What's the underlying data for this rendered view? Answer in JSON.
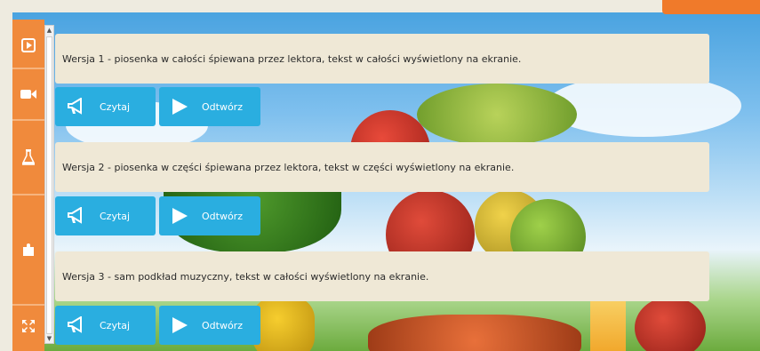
{
  "versions": [
    {
      "text": "Wersja 1 - piosenka w całości śpiewana przez lektora, tekst w całości wyświetlony na ekranie.",
      "read_label": "Czytaj",
      "play_label": "Odtwórz"
    },
    {
      "text": "Wersja 2 - piosenka w części śpiewana przez lektora, tekst w części wyświetlony na ekranie.",
      "read_label": "Czytaj",
      "play_label": "Odtwórz"
    },
    {
      "text": "Wersja 3 - sam podkład muzyczny, tekst w całości wyświetlony na ekranie.",
      "read_label": "Czytaj",
      "play_label": "Odtwórz"
    }
  ],
  "sidebar": {
    "items": [
      {
        "icon": "play-square-icon"
      },
      {
        "icon": "video-camera-icon"
      },
      {
        "icon": "flask-icon"
      },
      {
        "icon": "puzzle-icon"
      },
      {
        "icon": "fullscreen-icon"
      }
    ]
  },
  "colors": {
    "accent_orange": "#f08a3c",
    "button_blue": "#2aaee0",
    "panel_beige": "#efe8d6"
  }
}
